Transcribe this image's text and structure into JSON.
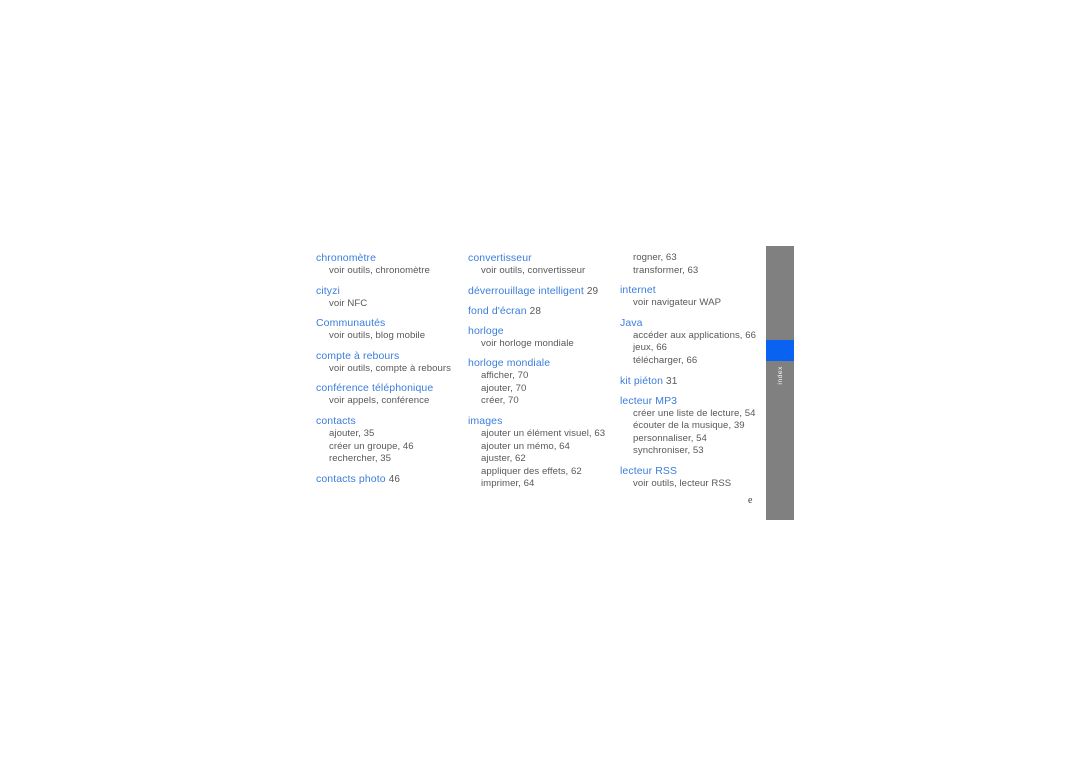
{
  "document": {
    "folio": "e"
  },
  "sidebar": {
    "tab_label": "index",
    "bar_color": "#808080",
    "marker_color": "#0a62f0"
  },
  "colors": {
    "heading": "#3b7ddd",
    "body": "#58585a",
    "sidebar": "#808080",
    "marker": "#0a62f0"
  },
  "index": {
    "columns": [
      {
        "entries": [
          {
            "head": "chronomètre",
            "page": "",
            "subs": [
              "voir outils, chronomètre"
            ]
          },
          {
            "head": "cityzi",
            "page": "",
            "subs": [
              "voir NFC"
            ]
          },
          {
            "head": "Communautés",
            "page": "",
            "subs": [
              "voir outils, blog mobile"
            ]
          },
          {
            "head": "compte à rebours",
            "page": "",
            "subs": [
              "voir outils, compte à rebours"
            ]
          },
          {
            "head": "conférence téléphonique",
            "page": "",
            "subs": [
              "voir appels, conférence"
            ]
          },
          {
            "head": "contacts",
            "page": "",
            "subs": [
              "ajouter,  35",
              "créer un groupe,  46",
              "rechercher,  35"
            ]
          },
          {
            "head": "contacts photo",
            "page": "46",
            "subs": []
          }
        ]
      },
      {
        "entries": [
          {
            "head": "convertisseur",
            "page": "",
            "subs": [
              "voir outils, convertisseur"
            ]
          },
          {
            "head": "déverrouillage intelligent",
            "page": "29",
            "subs": []
          },
          {
            "head": "fond d'écran",
            "page": "28",
            "subs": []
          },
          {
            "head": "horloge",
            "page": "",
            "subs": [
              "voir horloge mondiale"
            ]
          },
          {
            "head": "horloge mondiale",
            "page": "",
            "subs": [
              "afficher,  70",
              "ajouter,  70",
              "créer,  70"
            ]
          },
          {
            "head": "images",
            "page": "",
            "subs": [
              "ajouter un élément visuel, 63",
              "ajouter un mémo,  64",
              "ajuster,  62",
              "appliquer des effets, 62",
              "imprimer,  64"
            ]
          }
        ]
      },
      {
        "entries": [
          {
            "head": "",
            "page": "",
            "subs": [
              "rogner,  63",
              "transformer,  63"
            ]
          },
          {
            "head": "internet",
            "page": "",
            "subs": [
              "voir navigateur WAP"
            ]
          },
          {
            "head": "Java",
            "page": "",
            "subs": [
              "accéder aux applications,  66",
              "jeux,  66",
              "télécharger,  66"
            ]
          },
          {
            "head": "kit piéton",
            "page": "31",
            "subs": []
          },
          {
            "head": "lecteur MP3",
            "page": "",
            "subs": [
              "créer une liste de lecture,  54",
              "écouter de la musique,  39",
              "personnaliser,  54",
              "synchroniser,  53"
            ]
          },
          {
            "head": "lecteur RSS",
            "page": "",
            "subs": [
              "voir outils, lecteur RSS"
            ]
          }
        ]
      }
    ]
  }
}
